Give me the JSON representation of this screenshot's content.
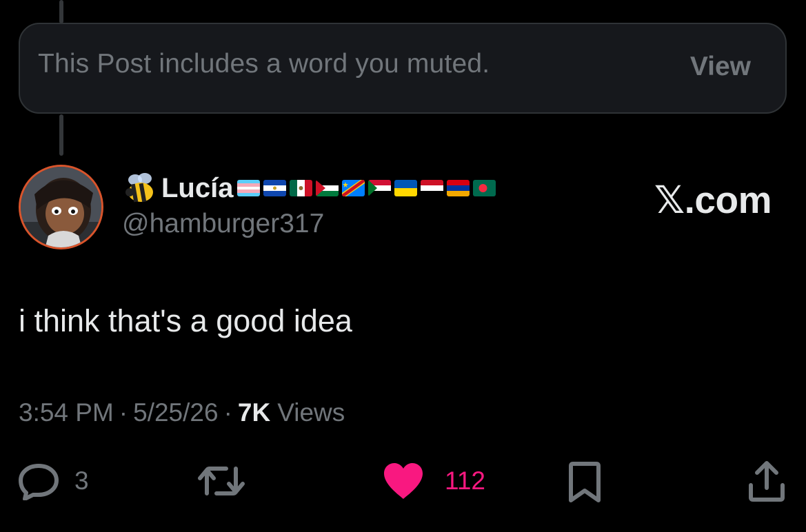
{
  "muted_post": {
    "message": "This Post includes a word you muted.",
    "view_label": "View"
  },
  "author": {
    "display_name": "Lucía",
    "handle": "@hamburger317",
    "name_emoji": "bee-icon",
    "flags": [
      "transgender-flag",
      "el-salvador-flag",
      "mexico-flag",
      "palestine-flag",
      "dr-congo-flag",
      "sudan-flag",
      "ukraine-flag",
      "yemen-flag",
      "armenia-flag",
      "bangladesh-flag"
    ]
  },
  "brand": {
    "label": "𝕏.com"
  },
  "post": {
    "text": "i think that's a good idea"
  },
  "meta": {
    "time": "3:54 PM",
    "separator": "·",
    "date": "5/25/26",
    "views_count": "7K",
    "views_label": "Views"
  },
  "actions": {
    "replies": "3",
    "likes": "112"
  },
  "colors": {
    "background": "#000000",
    "muted_card": "#16181c",
    "secondary_text": "#71767b",
    "primary_text": "#e7e9ea",
    "like": "#f91880",
    "avatar_ring": "#d9542b"
  }
}
